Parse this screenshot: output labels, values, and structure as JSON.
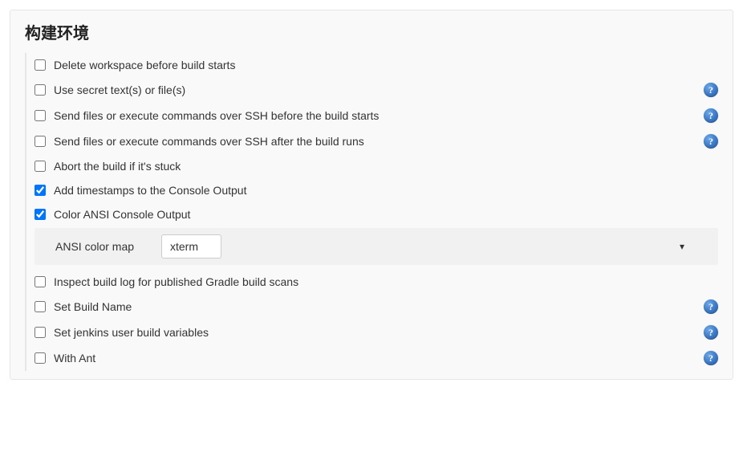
{
  "section": {
    "title": "构建环境"
  },
  "options": [
    {
      "id": "delete-workspace",
      "label": "Delete workspace before build starts",
      "checked": false,
      "help": false
    },
    {
      "id": "use-secret",
      "label": "Use secret text(s) or file(s)",
      "checked": false,
      "help": true
    },
    {
      "id": "ssh-before",
      "label": "Send files or execute commands over SSH before the build starts",
      "checked": false,
      "help": true
    },
    {
      "id": "ssh-after",
      "label": "Send files or execute commands over SSH after the build runs",
      "checked": false,
      "help": true
    },
    {
      "id": "abort-stuck",
      "label": "Abort the build if it's stuck",
      "checked": false,
      "help": false
    },
    {
      "id": "add-timestamps",
      "label": "Add timestamps to the Console Output",
      "checked": true,
      "help": false
    },
    {
      "id": "color-ansi",
      "label": "Color ANSI Console Output",
      "checked": true,
      "help": false
    },
    {
      "id": "inspect-gradle",
      "label": "Inspect build log for published Gradle build scans",
      "checked": false,
      "help": false
    },
    {
      "id": "set-build-name",
      "label": "Set Build Name",
      "checked": false,
      "help": true
    },
    {
      "id": "set-jenkins-vars",
      "label": "Set jenkins user build variables",
      "checked": false,
      "help": true
    },
    {
      "id": "with-ant",
      "label": "With Ant",
      "checked": false,
      "help": true
    }
  ],
  "ansi": {
    "label": "ANSI color map",
    "selected": "xterm"
  },
  "helpGlyph": "?"
}
